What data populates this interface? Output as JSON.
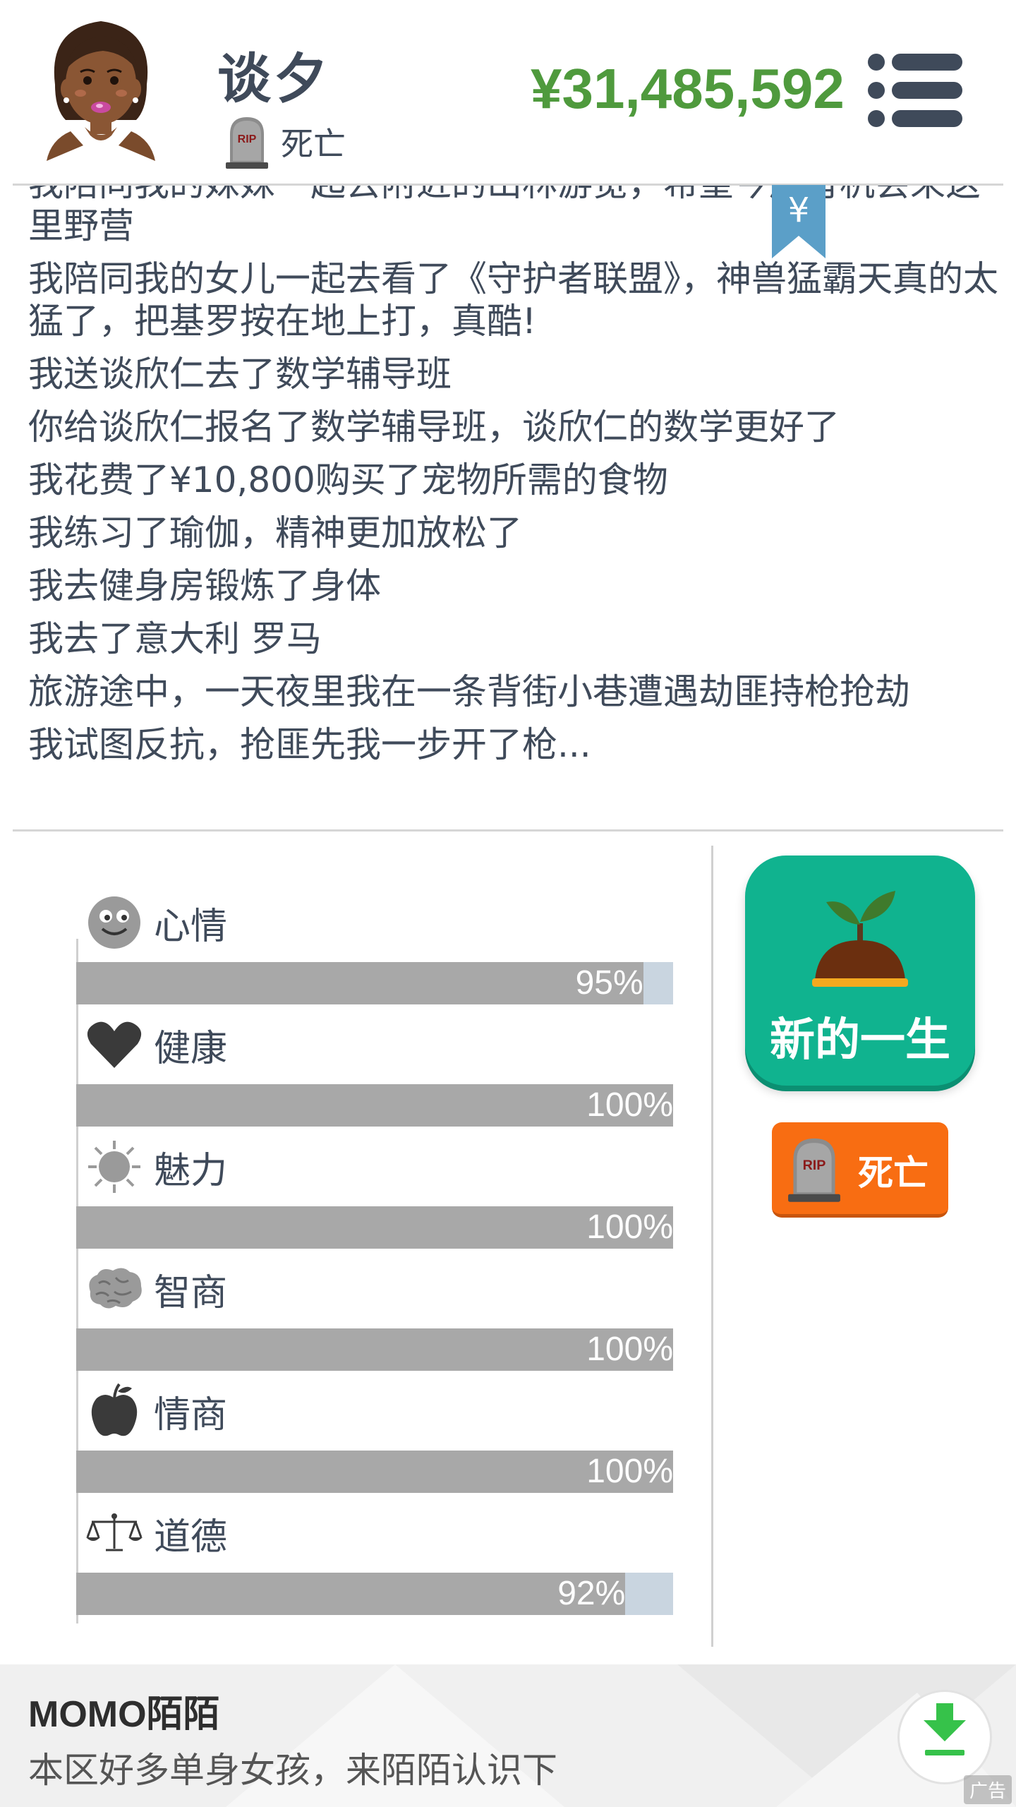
{
  "header": {
    "name": "谈夕",
    "status": "死亡",
    "money": "¥31,485,592"
  },
  "log": {
    "lines": [
      "我陪同我的妹妹一起去附近的山林游览，希望今后有机会来这里野营",
      "我陪同我的女儿一起去看了《守护者联盟》，神兽猛霸天真的太猛了，把基罗按在地上打，真酷!",
      "我送谈欣仁去了数学辅导班",
      "你给谈欣仁报名了数学辅导班，谈欣仁的数学更好了",
      "我花费了¥10,800购买了宠物所需的食物",
      "我练习了瑜伽，精神更加放松了",
      "我去健身房锻炼了身体",
      "我去了意大利 罗马",
      "旅游途中，一天夜里我在一条背街小巷遭遇劫匪持枪抢劫",
      "我试图反抗，抢匪先我一步开了枪..."
    ]
  },
  "bookmark": {
    "symbol": "¥"
  },
  "stats": [
    {
      "label": "心情",
      "value": 95,
      "display": "95%",
      "icon": "smiley-icon"
    },
    {
      "label": "健康",
      "value": 100,
      "display": "100%",
      "icon": "heart-icon"
    },
    {
      "label": "魅力",
      "value": 100,
      "display": "100%",
      "icon": "sun-icon"
    },
    {
      "label": "智商",
      "value": 100,
      "display": "100%",
      "icon": "brain-icon"
    },
    {
      "label": "情商",
      "value": 100,
      "display": "100%",
      "icon": "apple-icon"
    },
    {
      "label": "道德",
      "value": 92,
      "display": "92%",
      "icon": "scales-icon"
    }
  ],
  "buttons": {
    "new_life": "新的一生",
    "death": "死亡",
    "tombstone_text": "RIP"
  },
  "ad": {
    "title": "MOMO陌陌",
    "desc": "本区好多单身女孩，来陌陌认识下",
    "tag": "广告"
  },
  "colors": {
    "money": "#4f9a3d",
    "new_life_bg": "#10b38f",
    "death_bg": "#f86d12",
    "bar_fill": "#a8a8a8",
    "bar_track": "#c9d5e0"
  }
}
